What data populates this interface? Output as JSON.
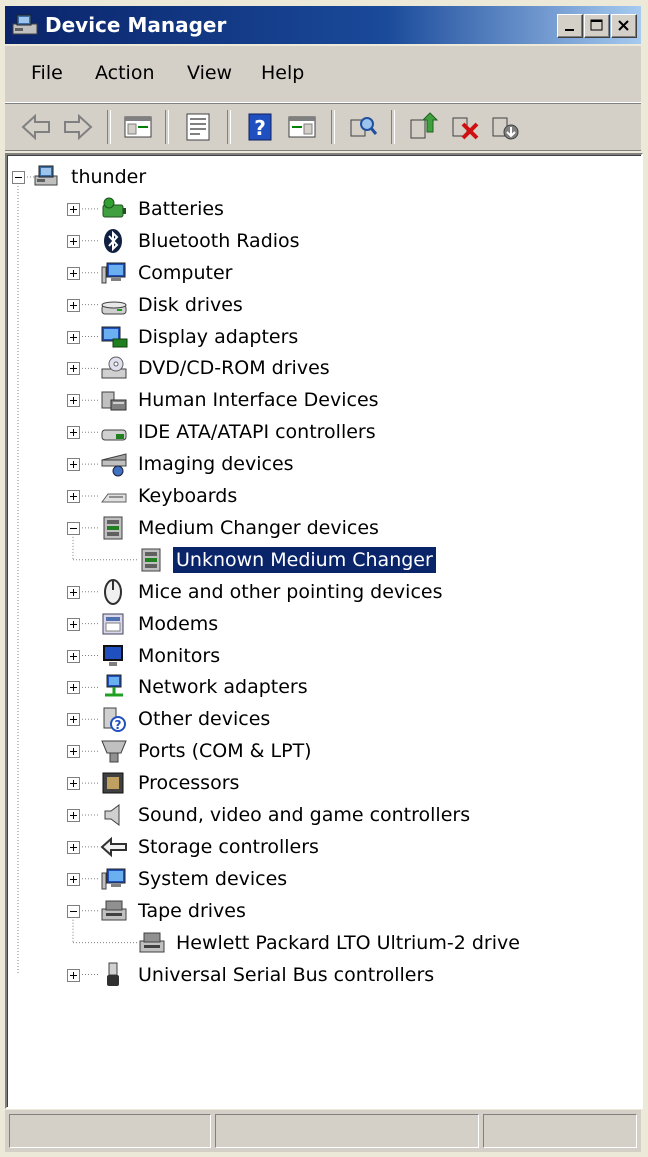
{
  "window": {
    "title": "Device Manager",
    "minimize_label": "_",
    "maximize_label": "□",
    "close_label": "×"
  },
  "menu": {
    "items": [
      "File",
      "Action",
      "View",
      "Help"
    ]
  },
  "toolbar": {
    "buttons": [
      "back-icon",
      "forward-icon",
      "show-hide-console-tree-icon",
      "properties-icon",
      "help-icon",
      "export-list-icon",
      "scan-hardware-icon",
      "update-driver-icon",
      "uninstall-icon",
      "disable-icon"
    ]
  },
  "tree": {
    "root": "thunder",
    "items": [
      {
        "label": "Batteries",
        "icon": "battery-icon",
        "expanded": false
      },
      {
        "label": "Bluetooth Radios",
        "icon": "bluetooth-icon",
        "expanded": false
      },
      {
        "label": "Computer",
        "icon": "computer-icon",
        "expanded": false
      },
      {
        "label": "Disk drives",
        "icon": "disk-drive-icon",
        "expanded": false
      },
      {
        "label": "Display adapters",
        "icon": "display-adapter-icon",
        "expanded": false
      },
      {
        "label": "DVD/CD-ROM drives",
        "icon": "dvd-drive-icon",
        "expanded": false
      },
      {
        "label": "Human Interface Devices",
        "icon": "hid-icon",
        "expanded": false
      },
      {
        "label": "IDE ATA/ATAPI controllers",
        "icon": "ide-controller-icon",
        "expanded": false
      },
      {
        "label": "Imaging devices",
        "icon": "imaging-device-icon",
        "expanded": false
      },
      {
        "label": "Keyboards",
        "icon": "keyboard-icon",
        "expanded": false
      },
      {
        "label": "Medium Changer devices",
        "icon": "medium-changer-icon",
        "expanded": true,
        "children": [
          {
            "label": "Unknown Medium Changer",
            "icon": "medium-changer-icon",
            "selected": true
          }
        ]
      },
      {
        "label": "Mice and other pointing devices",
        "icon": "mouse-icon",
        "expanded": false
      },
      {
        "label": "Modems",
        "icon": "modem-icon",
        "expanded": false
      },
      {
        "label": "Monitors",
        "icon": "monitor-icon",
        "expanded": false
      },
      {
        "label": "Network adapters",
        "icon": "network-adapter-icon",
        "expanded": false
      },
      {
        "label": "Other devices",
        "icon": "other-devices-icon",
        "expanded": false
      },
      {
        "label": "Ports (COM & LPT)",
        "icon": "port-icon",
        "expanded": false
      },
      {
        "label": "Processors",
        "icon": "processor-icon",
        "expanded": false
      },
      {
        "label": "Sound, video and game controllers",
        "icon": "sound-icon",
        "expanded": false
      },
      {
        "label": "Storage controllers",
        "icon": "storage-controller-icon",
        "expanded": false
      },
      {
        "label": "System devices",
        "icon": "system-devices-icon",
        "expanded": false
      },
      {
        "label": "Tape drives",
        "icon": "tape-drive-icon",
        "expanded": true,
        "children": [
          {
            "label": "Hewlett Packard LTO Ultrium-2 drive",
            "icon": "tape-drive-icon",
            "selected": false
          }
        ]
      },
      {
        "label": "Universal Serial Bus controllers",
        "icon": "usb-icon",
        "expanded": false
      }
    ]
  },
  "colors": {
    "selection": "#0a246a",
    "title_bar_start": "#0a246a",
    "title_bar_end": "#a6caf0"
  }
}
